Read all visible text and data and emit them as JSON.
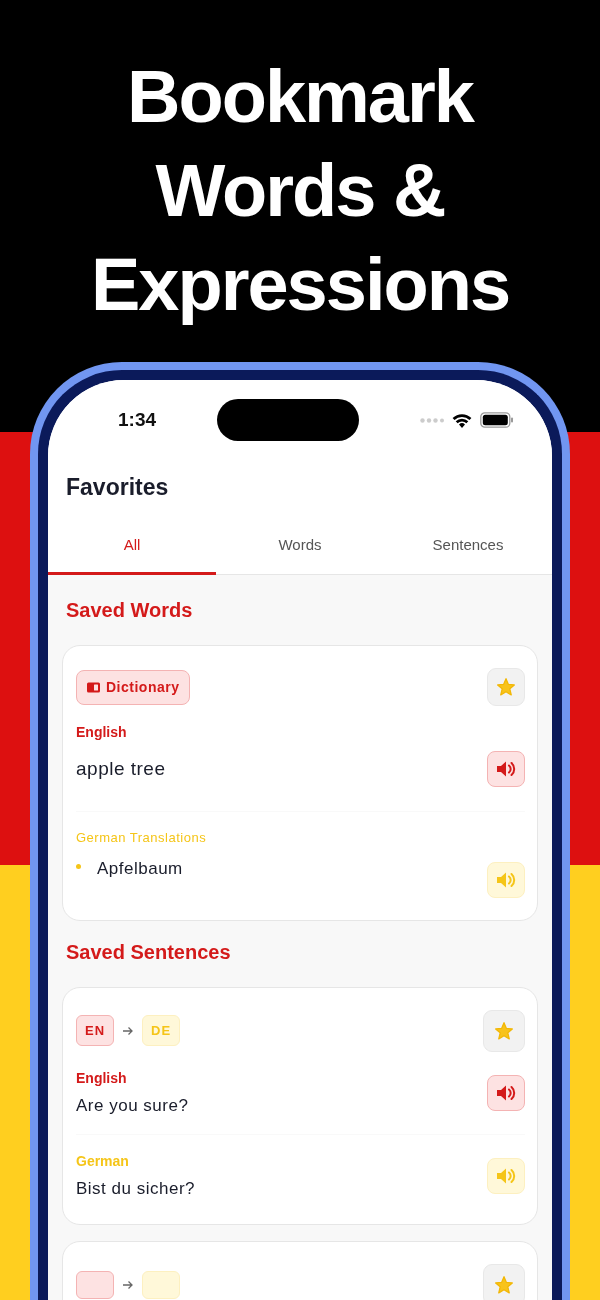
{
  "headline": "Bookmark Words & Expressions",
  "status_bar": {
    "time": "1:34"
  },
  "screen_title": "Favorites",
  "tabs": [
    {
      "label": "All",
      "selected": true
    },
    {
      "label": "Words",
      "selected": false
    },
    {
      "label": "Sentences",
      "selected": false
    }
  ],
  "sections": [
    {
      "title": "Saved Words",
      "cards": [
        {
          "kind": "word",
          "starred": true,
          "source_badge": "Dictionary",
          "source_label": "English",
          "source_text": "apple tree",
          "target_label": "German Translations",
          "translations": [
            "Apfelbaum"
          ]
        }
      ]
    },
    {
      "title": "Saved Sentences",
      "cards": [
        {
          "kind": "sentence",
          "starred": true,
          "from": "EN",
          "to": "DE",
          "source_label": "English",
          "source_text": "Are you sure?",
          "target_label": "German",
          "target_text": "Bist du sicher?"
        },
        {
          "kind": "sentence",
          "starred": true
        }
      ]
    }
  ]
}
